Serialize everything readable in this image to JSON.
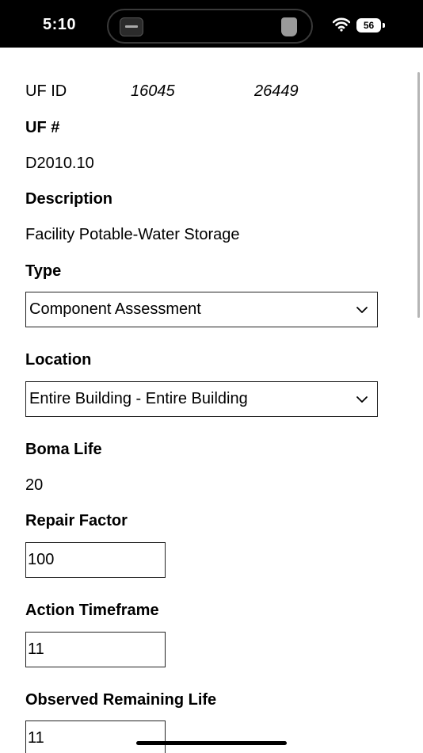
{
  "status_bar": {
    "time": "5:10",
    "battery_level": "56",
    "icons": [
      "now-playing-album-icon",
      "now-playing-cup-icon",
      "wifi-icon",
      "battery-icon"
    ]
  },
  "form": {
    "uf_id_label": "UF ID",
    "uf_id_value_1": "16045",
    "uf_id_value_2": "26449",
    "uf_number_label": "UF #",
    "uf_number_value": "D2010.10",
    "description_label": "Description",
    "description_value": "Facility Potable-Water Storage",
    "type_label": "Type",
    "type_value": "Component Assessment",
    "location_label": "Location",
    "location_value": "Entire Building - Entire Building",
    "boma_life_label": "Boma Life",
    "boma_life_value": "20",
    "repair_factor_label": "Repair Factor",
    "repair_factor_value": "100",
    "action_timeframe_label": "Action Timeframe",
    "action_timeframe_value": "11",
    "observed_remaining_life_label": "Observed Remaining Life",
    "observed_remaining_life_value": "11"
  }
}
